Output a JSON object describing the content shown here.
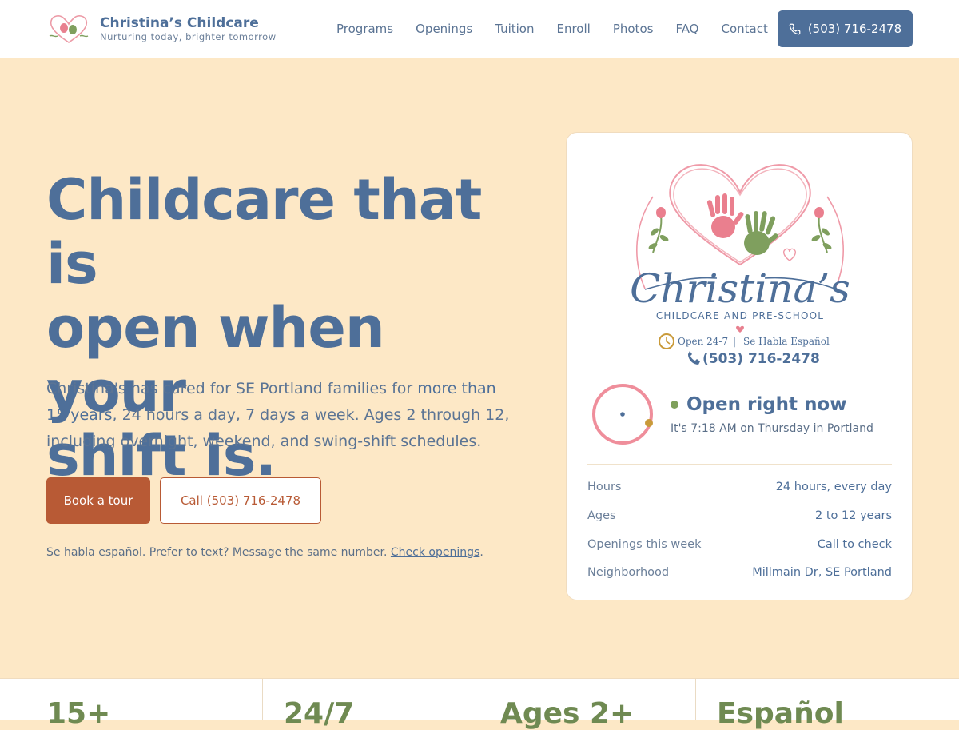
{
  "header": {
    "brand_name": "Christina’s Childcare",
    "brand_tagline": "Nurturing today, brighter tomorrow",
    "nav": [
      "Programs",
      "Openings",
      "Tuition",
      "Enroll",
      "Photos",
      "FAQ",
      "Contact"
    ],
    "phone_button": "(503) 716-2478"
  },
  "hero": {
    "title_lines": [
      "Childcare that is",
      "open when your",
      "shift is."
    ],
    "subtitle_pre": "Christina's has cared for SE Portland families for ",
    "subtitle_highlight": "more than 15 years",
    "subtitle_post": ", 24 hours a day, 7 days a week. Ages 2 through 12, including overnight, weekend, and swing-shift schedules.",
    "primary_button": "Book a tour",
    "secondary_button": "Call (503) 716-2478",
    "note_text": "Se habla español. Prefer to text? Message the same number. ",
    "note_link": "Check openings",
    "note_end": "."
  },
  "card": {
    "logo": {
      "name": "Christina’s",
      "line2": "CHILDCARE AND PRE-SCHOOL",
      "open": "Open 24-7",
      "sep": "|",
      "spanish": "Se Habla Español",
      "phone": "(503) 716-2478"
    },
    "status_title": "Open right now",
    "status_time": "It's 7:18 AM on Thursday in Portland",
    "status_color": "#7fa05b",
    "rows": [
      {
        "label": "Hours",
        "value": "24 hours, every day"
      },
      {
        "label": "Ages",
        "value": "2 to 12 years"
      },
      {
        "label": "Openings this week",
        "value": "Call to check"
      },
      {
        "label": "Neighborhood",
        "value": "Millmain Dr, SE Portland"
      }
    ]
  },
  "stats": [
    "15+",
    "24/7",
    "Ages 2+",
    "Español"
  ],
  "colors": {
    "accent": "#4e6f99",
    "brand_orange": "#b85a35",
    "background": "#fde8c6",
    "stat_green": "#6f8a52"
  }
}
